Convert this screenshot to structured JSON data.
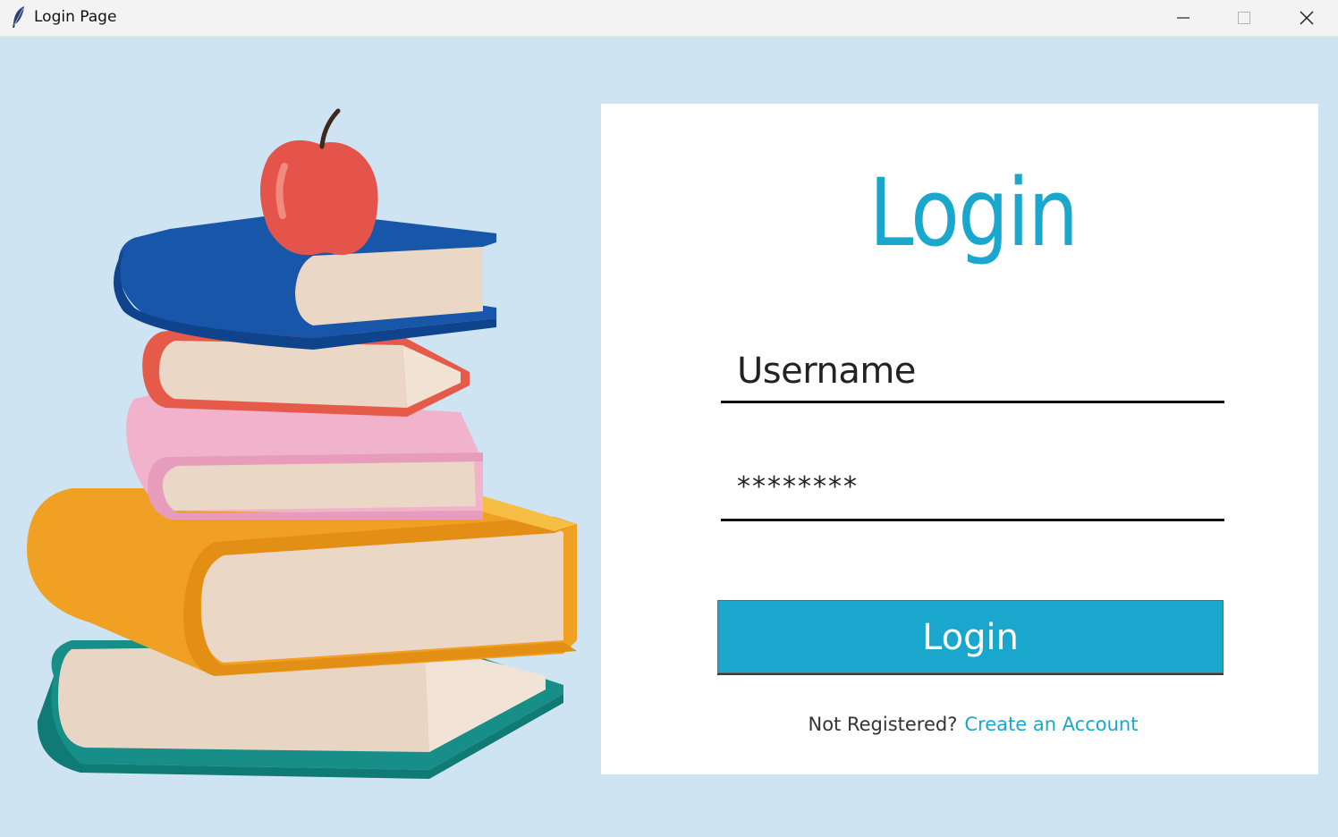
{
  "window": {
    "title": "Login Page",
    "icon": "feather-icon",
    "controls": [
      "minimize-icon",
      "maximize-icon",
      "close-icon"
    ]
  },
  "login_card": {
    "heading": "Login",
    "username": {
      "value": "Username"
    },
    "password": {
      "value": "********"
    },
    "submit_label": "Login",
    "register_prompt": "Not Registered?",
    "register_link": "Create an Account"
  },
  "illustration": {
    "icon": "books-with-apple-illustration"
  },
  "colors": {
    "background": "#cfe4f2",
    "accent": "#1aa7cd",
    "card": "#ffffff"
  }
}
